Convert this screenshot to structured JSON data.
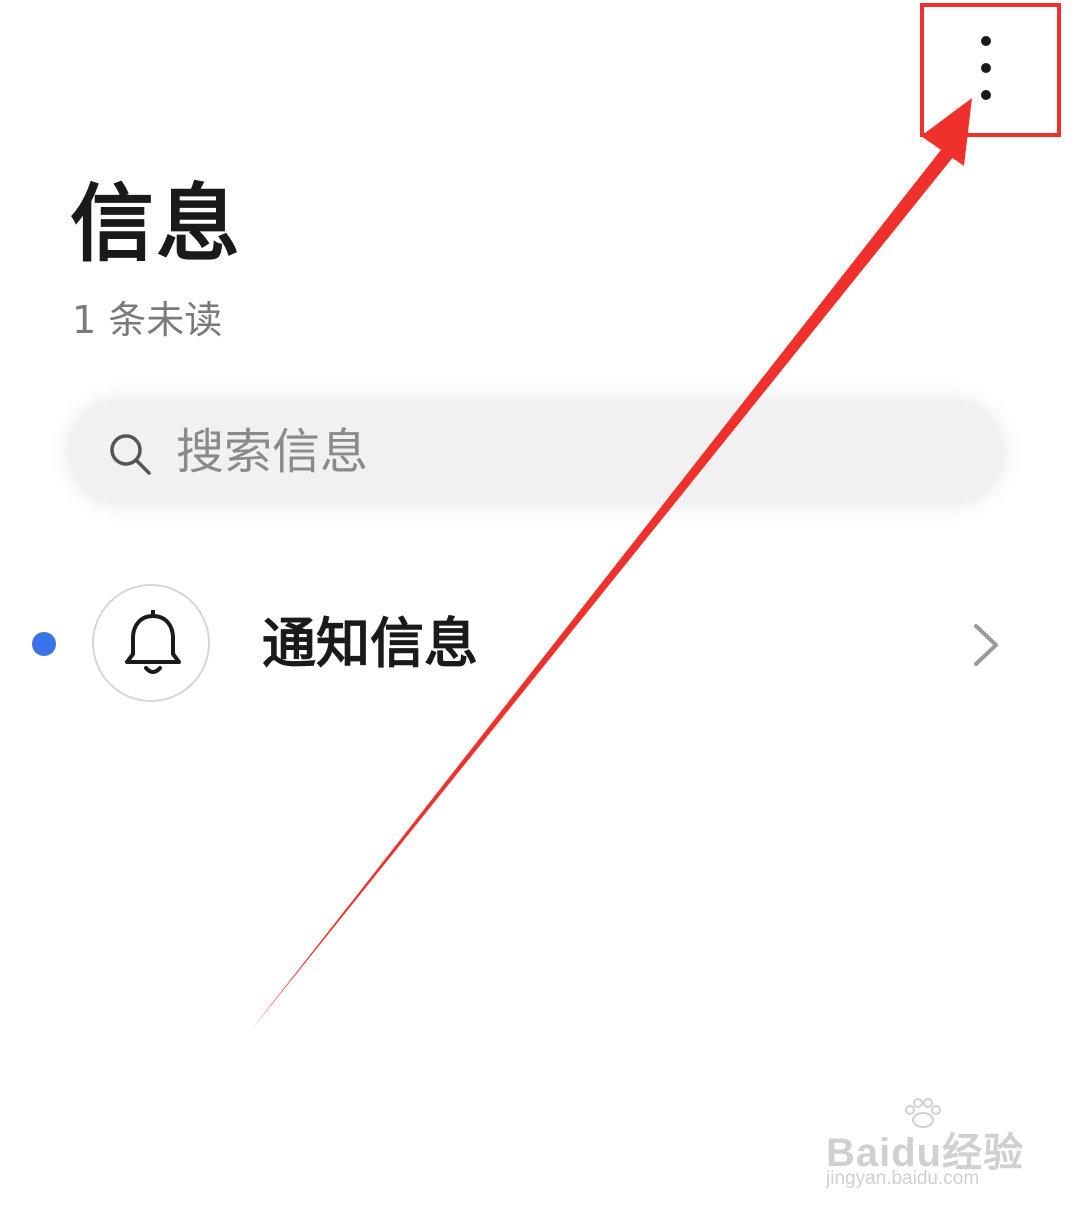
{
  "header": {
    "title": "信息",
    "unread_text": "1 条未读",
    "more_icon": "more-vertical-icon"
  },
  "search": {
    "placeholder": "搜索信息",
    "value": "",
    "icon": "search-icon"
  },
  "list": {
    "items": [
      {
        "label": "通知信息",
        "icon": "bell-icon",
        "unread": true,
        "trailing_icon": "chevron-right-icon"
      }
    ]
  },
  "annotation": {
    "color": "#f0302a",
    "target": "more-button"
  },
  "watermark": {
    "logo": "Baidu经验",
    "url": "jingyan.baidu.com"
  },
  "colors": {
    "accent_dot": "#3b74ea",
    "title": "#1a1a1a",
    "subtitle": "#7a7a7a",
    "search_bg": "#f1f1f1"
  }
}
